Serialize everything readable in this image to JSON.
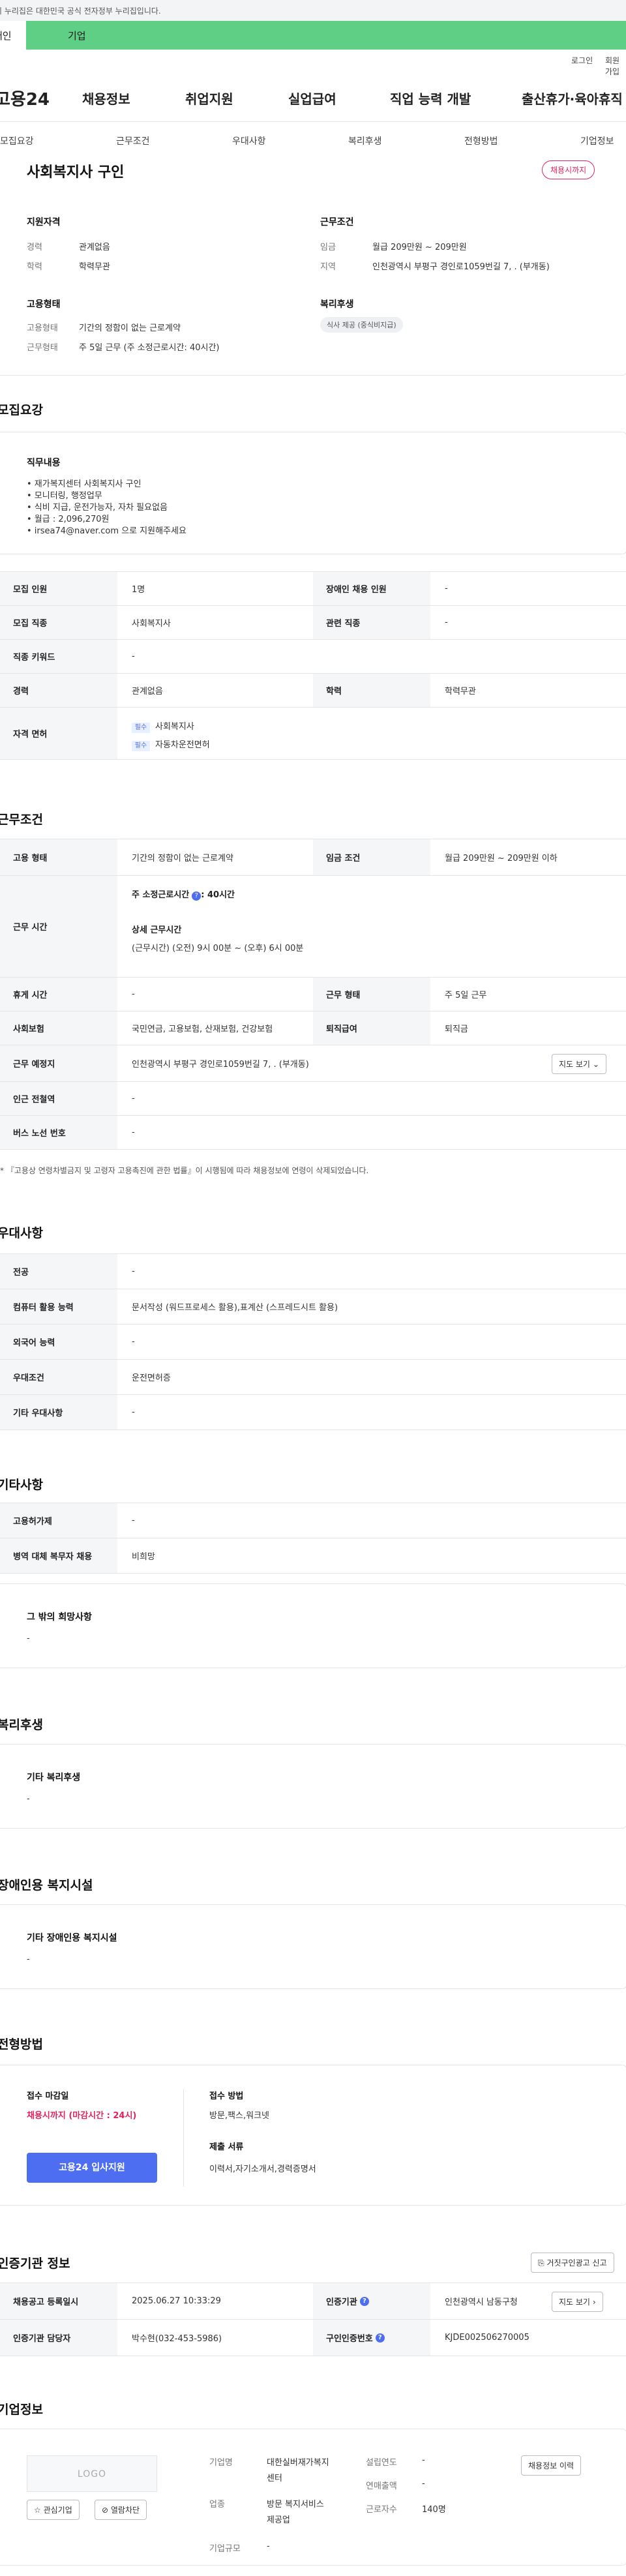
{
  "gov_banner": "이 누리집은 대한민국 공식 전자정부 누리집입니다.",
  "top_tabs": {
    "first": "개인",
    "second": "기업"
  },
  "util": {
    "login": "로그인",
    "join": "회원가입"
  },
  "gnb": {
    "logo": "고용24",
    "items": [
      "채용정보",
      "취업지원",
      "실업급여",
      "직업 능력 개발",
      "출산휴가·육아휴직"
    ]
  },
  "snb": [
    "모집요강",
    "근무조건",
    "우대사항",
    "복리후생",
    "전형방법",
    "기업정보"
  ],
  "summary": {
    "title": "사회복지사 구인",
    "badge": "채용시까지",
    "qual_title": "지원자격",
    "qual": [
      {
        "k": "경력",
        "v": "관계없음"
      },
      {
        "k": "학력",
        "v": "학력무관"
      }
    ],
    "cond_title": "근무조건",
    "cond": [
      {
        "k": "임금",
        "v": "월급 209만원 ~ 209만원"
      },
      {
        "k": "지역",
        "v": "인천광역시 부평구 경인로1059번길 7, . (부개동)"
      }
    ],
    "emp_title": "고용형태",
    "emp": [
      {
        "k": "고용형태",
        "v": "기간의 정함이 없는 근로계약"
      },
      {
        "k": "근무형태",
        "v": "주 5일 근무 (주 소정근로시간: 40시간)"
      }
    ],
    "welfare_title": "복리후생",
    "welfare_chip": "식사 제공 (중식비지급)"
  },
  "recruit": {
    "title": "모집요강",
    "duty_title": "직무내용",
    "duty_lines": [
      "• 재가복지센터 사회복지사 구인",
      "• 모니터링, 행정업무",
      "• 식비 지급, 운전가능자, 자차 필요없음",
      "• 월급 : 2,096,270원",
      "• irsea74@naver.com 으로 지원해주세요"
    ],
    "rows": [
      {
        "k1": "모집 인원",
        "v1": "1명",
        "k2": "장애인 채용 인원",
        "v2": "-"
      },
      {
        "k1": "모집 직종",
        "v1": "사회복지사",
        "k2": "관련 직종",
        "v2": "-"
      },
      {
        "k1": "직종 키워드",
        "v1": "-"
      },
      {
        "k1": "경력",
        "v1": "관계없음",
        "k2": "학력",
        "v2": "학력무관"
      }
    ],
    "license_label": "자격 면허",
    "licenses": [
      {
        "tag": "필수",
        "name": "사회복지사"
      },
      {
        "tag": "필수",
        "name": "자동차운전면허"
      }
    ]
  },
  "work": {
    "title": "근무조건",
    "r1": {
      "k1": "고용 형태",
      "v1": "기간의 정함이 없는 근로계약",
      "k2": "임금 조건",
      "v2": "월급 209만원 ~ 209만원 이하"
    },
    "hours_label": "근무 시간",
    "hours_main": "주 소정근로시간",
    "hours_main_val": ": 40시간",
    "hours_detail_title": "상세 근무시간",
    "hours_detail": "(근무시간) (오전) 9시 00분 ~ (오후) 6시 00분",
    "r3": {
      "k1": "휴게 시간",
      "v1": "-",
      "k2": "근무 형태",
      "v2": "주 5일 근무"
    },
    "r4": {
      "k1": "사회보험",
      "v1": "국민연금, 고용보험, 산재보험, 건강보험",
      "k2": "퇴직급여",
      "v2": "퇴직금"
    },
    "r5": {
      "k1": "근무 예정지",
      "v1": "인천광역시 부평구 경인로1059번길 7, . (부개동)",
      "btn": "지도 보기"
    },
    "r6": {
      "k1": "인근 전철역",
      "v1": "-"
    },
    "r7": {
      "k1": "버스 노선 번호",
      "v1": "-"
    },
    "note": "* 『고용상 연령차별금지 및 고령자 고용촉진에 관한 법률』이 시행됨에 따라 채용정보에 연령이 삭제되었습니다."
  },
  "pref": {
    "title": "우대사항",
    "rows": [
      {
        "k": "전공",
        "v": "-"
      },
      {
        "k": "컴퓨터 활용 능력",
        "v": "문서작성 (워드프로세스 활용),표계산 (스프레드시트 활용)"
      },
      {
        "k": "외국어 능력",
        "v": "-"
      },
      {
        "k": "우대조건",
        "v": "운전면허증"
      },
      {
        "k": "기타 우대사항",
        "v": "-"
      }
    ]
  },
  "etc": {
    "title": "기타사항",
    "rows": [
      {
        "k": "고용허가제",
        "v": "-"
      },
      {
        "k": "병역 대체 복무자 채용",
        "v": "비희망"
      }
    ],
    "other_title": "그 밖의 희망사항",
    "other_val": "-"
  },
  "benefit": {
    "title": "복리후생",
    "sub": "기타 복리후생",
    "val": "-"
  },
  "disab": {
    "title": "장애인용 복지시설",
    "sub": "기타 장애인용 복지시설",
    "val": "-"
  },
  "screen": {
    "title": "전형방법",
    "deadline_label": "접수 마감일",
    "deadline_val": "채용시까지 (마감시간 : 24시)",
    "apply_btn": "고용24 입사지원",
    "method_label": "접수 방법",
    "method_val": "방문,팩스,워크넷",
    "docs_label": "제출 서류",
    "docs_val": "이력서,자기소개서,경력증명서"
  },
  "agency": {
    "title": "인증기관 정보",
    "report_btn": "거짓구인광고 신고",
    "r1": {
      "k1": "채용공고 등록일시",
      "v1": "2025.06.27 10:33:29",
      "k2": "인증기관",
      "v2": "인천광역시 남동구청",
      "btn": "지도 보기"
    },
    "r2": {
      "k1": "인증기관 담당자",
      "v1": "박수현(032-453-5986)",
      "k2": "구인인증번호",
      "v2": "KJDE002506270005"
    }
  },
  "company": {
    "title": "기업정보",
    "logo": "LOGO",
    "fav_btn": "관심기업",
    "block_btn": "열람차단",
    "history_btn": "채용정보 이력",
    "name_k": "기업명",
    "name_v": [
      "대한실버재가복지",
      "센터"
    ],
    "biz_k": "업종",
    "biz_v": [
      "방문 복지서비스",
      "제공업"
    ],
    "size_k": "기업규모",
    "size_v": "-",
    "year_k": "설립연도",
    "year_v": "-",
    "sales_k": "연매출액",
    "sales_v": "-",
    "emp_k": "근로자수",
    "emp_v": "140명"
  },
  "colors": {
    "accent": "#4d6ef0",
    "green_tab": "#5ecf85",
    "badge": "#e0245e"
  }
}
